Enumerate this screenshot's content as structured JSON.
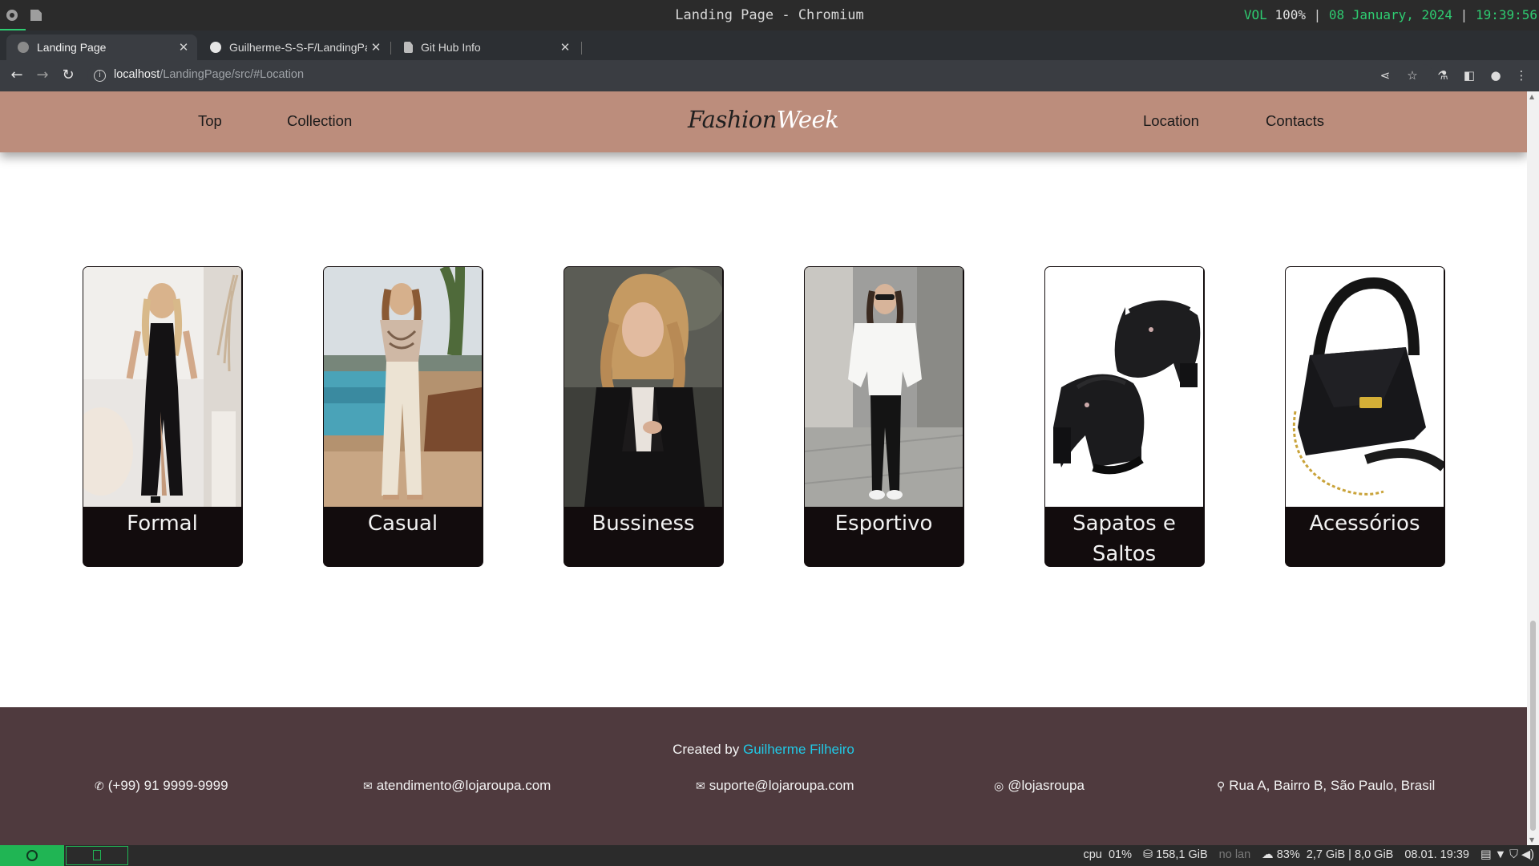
{
  "os": {
    "window_title": "Landing Page - Chromium",
    "status": {
      "vol_label": "VOL",
      "vol_value": "100%",
      "date": "08 January, 2024",
      "time": "19:39:56"
    }
  },
  "browser": {
    "tabs": [
      {
        "label": "Landing Page",
        "active": true,
        "favicon": "globe-icon"
      },
      {
        "label": "Guilherme-S-S-F/LandingPag",
        "active": false,
        "favicon": "github-icon"
      },
      {
        "label": "Git Hub Info",
        "active": false,
        "favicon": "page-icon"
      }
    ],
    "url_host": "localhost",
    "url_path": "/LandingPage/src/#Location"
  },
  "site": {
    "nav": {
      "top": "Top",
      "collection": "Collection",
      "location": "Location",
      "contacts": "Contacts"
    },
    "brand": {
      "part1": "Fashion",
      "part2": "Week"
    },
    "cards": [
      {
        "label": "Formal",
        "image": "woman in black slit dress"
      },
      {
        "label": "Casual",
        "image": "woman in sequin top and cream trousers by pool"
      },
      {
        "label": "Bussiness",
        "image": "woman in black blazer"
      },
      {
        "label": "Esportivo",
        "image": "woman in white top and black leggings"
      },
      {
        "label": "Sapatos e Saltos",
        "image": "black platform heels"
      },
      {
        "label": "Acessórios",
        "image": "black handbag"
      }
    ],
    "footer": {
      "credit_prefix": "Created by",
      "credit_author": "Guilherme Filheiro",
      "phone": "(+99) 91 9999-9999",
      "email_service": "atendimento@lojaroupa.com",
      "email_support": "suporte@lojaroupa.com",
      "instagram": "@lojasroupa",
      "address": "Rua A, Bairro B, São Paulo, Brasil"
    }
  },
  "system_tray": {
    "cpu_label": "cpu",
    "cpu_value": "01%",
    "disk": "158,1 GiB",
    "lan": "no lan",
    "battery": "83%",
    "mem_used": "2,7 GiB",
    "mem_total": "8,0 GiB",
    "datetime": "08.01. 19:39"
  },
  "colors": {
    "header_bg": "#bc8d7c",
    "footer_bg": "#4f3a3e",
    "card_bg": "#120c0d",
    "author_link": "#20c9e6",
    "os_accent": "#2ecc71"
  }
}
